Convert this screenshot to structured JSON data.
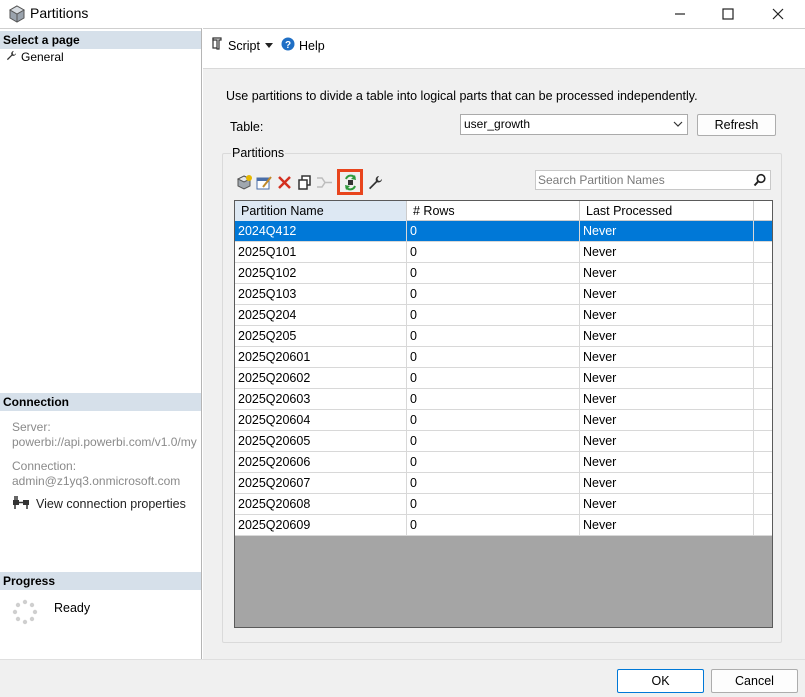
{
  "window": {
    "title": "Partitions"
  },
  "left_pane": {
    "select_page_header": "Select a page",
    "pages": [
      {
        "label": "General",
        "icon": "wrench-icon"
      }
    ],
    "connection_header": "Connection",
    "server_label": "Server:",
    "server_value": "powerbi://api.powerbi.com/v1.0/my",
    "connection_label": "Connection:",
    "connection_value": "admin@z1yq3.onmicrosoft.com",
    "view_connection_label": "View connection properties",
    "progress_header": "Progress",
    "progress_status": "Ready"
  },
  "top_toolbar": {
    "script_label": "Script",
    "help_label": "Help"
  },
  "main": {
    "description": "Use partitions to divide a table into logical parts that can be processed independently.",
    "table_label": "Table:",
    "table_value": "user_growth",
    "refresh_label": "Refresh",
    "partitions_label": "Partitions",
    "search_placeholder": "Search Partition Names",
    "columns": [
      "Partition Name",
      "# Rows",
      "Last Processed"
    ],
    "rows": [
      {
        "name": "2024Q412",
        "rows": "0",
        "last": "Never"
      },
      {
        "name": "2025Q101",
        "rows": "0",
        "last": "Never"
      },
      {
        "name": "2025Q102",
        "rows": "0",
        "last": "Never"
      },
      {
        "name": "2025Q103",
        "rows": "0",
        "last": "Never"
      },
      {
        "name": "2025Q204",
        "rows": "0",
        "last": "Never"
      },
      {
        "name": "2025Q205",
        "rows": "0",
        "last": "Never"
      },
      {
        "name": "2025Q20601",
        "rows": "0",
        "last": "Never"
      },
      {
        "name": "2025Q20602",
        "rows": "0",
        "last": "Never"
      },
      {
        "name": "2025Q20603",
        "rows": "0",
        "last": "Never"
      },
      {
        "name": "2025Q20604",
        "rows": "0",
        "last": "Never"
      },
      {
        "name": "2025Q20605",
        "rows": "0",
        "last": "Never"
      },
      {
        "name": "2025Q20606",
        "rows": "0",
        "last": "Never"
      },
      {
        "name": "2025Q20607",
        "rows": "0",
        "last": "Never"
      },
      {
        "name": "2025Q20608",
        "rows": "0",
        "last": "Never"
      },
      {
        "name": "2025Q20609",
        "rows": "0",
        "last": "Never"
      }
    ]
  },
  "footer": {
    "ok_label": "OK",
    "cancel_label": "Cancel"
  },
  "colors": {
    "selection": "#0078d7",
    "highlight_border": "#e8451d",
    "section_header": "#d6e0ea"
  }
}
